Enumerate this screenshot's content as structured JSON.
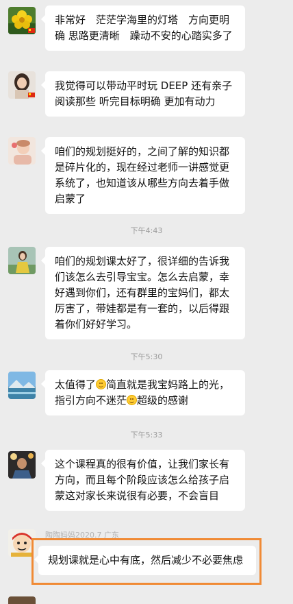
{
  "messages": [
    {
      "text": "非常好　茫茫学海里的灯塔　方向更明确 思路更清晰　躁动不安的心踏实多了"
    },
    {
      "text": "我觉得可以带动平时玩 DEEP 还有亲子阅读那些 听完目标明确 更加有动力"
    },
    {
      "text": "咱们的规划挺好的，之间了解的知识都是碎片化的，现在经过老师一讲感觉更系统了，也知道该从哪些方向去着手做启蒙了"
    },
    {
      "text": "咱们的规划课太好了，很详细的告诉我们该怎么去引导宝宝。怎么去启蒙，幸好遇到你们，还有群里的宝妈们，都太厉害了，带娃都是有一套的，以后得跟着你们好好学习。"
    },
    {
      "text_a": "太值得了",
      "text_b": "简直就是我宝妈路上的光，指引方向不迷茫",
      "text_c": "超级的感谢"
    },
    {
      "text": "这个课程真的很有价值，让我们家长有方向，而且每个阶段应该怎么给孩子启蒙这对家长来说很有必要，不会盲目"
    },
    {
      "sender": "陶陶妈妈2020.7 广东",
      "text": "规划课就是心中有底，然后减少不必要焦虑"
    }
  ],
  "timestamps": [
    "下午4:43",
    "下午5:30",
    "下午5:33"
  ],
  "icons": {
    "emoji": "smile-emoji-icon",
    "flag": "china-flag-icon"
  },
  "colors": {
    "background": "#ececec",
    "bubble": "#ffffff",
    "highlight": "#f08a35",
    "timestamp": "#9a9a9a"
  }
}
